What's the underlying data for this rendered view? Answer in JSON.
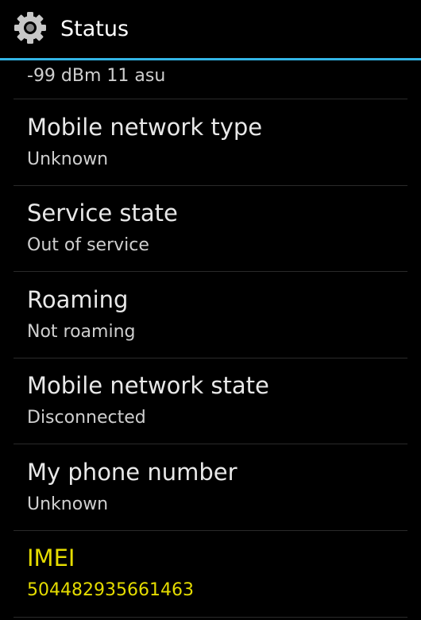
{
  "header": {
    "title": "Status",
    "icon": "gear-icon",
    "accent_color": "#33b5e5"
  },
  "rows": [
    {
      "summary": "-99 dBm   11 asu"
    },
    {
      "title": "Mobile network type",
      "summary": "Unknown"
    },
    {
      "title": "Service state",
      "summary": "Out of service"
    },
    {
      "title": "Roaming",
      "summary": "Not roaming"
    },
    {
      "title": "Mobile network state",
      "summary": "Disconnected"
    },
    {
      "title": "My phone number",
      "summary": "Unknown"
    },
    {
      "title": "IMEI",
      "summary": "504482935661463",
      "highlight_color": "#e5dc00"
    }
  ]
}
